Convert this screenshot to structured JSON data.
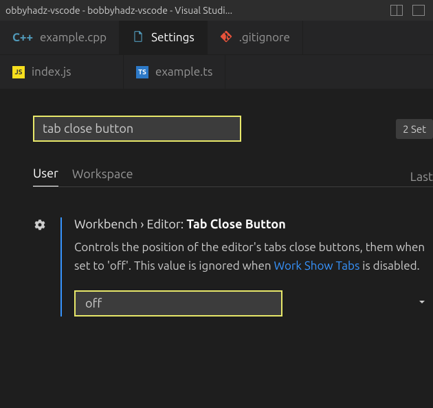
{
  "titlebar": {
    "text": "obbyhadz-vscode - bobbyhadz-vscode - Visual Studi..."
  },
  "tabs_row1": [
    {
      "name": "example-cpp",
      "label": "example.cpp",
      "icon": "cpp",
      "active": false
    },
    {
      "name": "settings",
      "label": "Settings",
      "icon": "file",
      "active": true
    },
    {
      "name": "gitignore",
      "label": ".gitignore",
      "icon": "git",
      "active": false
    }
  ],
  "tabs_row2": [
    {
      "name": "index-js",
      "label": "index.js",
      "icon": "js",
      "active": false
    },
    {
      "name": "example-ts",
      "label": "example.ts",
      "icon": "ts",
      "active": false
    }
  ],
  "settings": {
    "search_value": "tab close button",
    "count_label": "2 Set",
    "scope": {
      "user": "User",
      "workspace": "Workspace",
      "right": "Last"
    },
    "item": {
      "breadcrumb": "Workbench › Editor:",
      "name": "Tab Close Button",
      "desc_part1": "Controls the position of the editor's tabs close buttons",
      "desc_part2": "them when set to 'off'. This value is ignored when ",
      "link1": "Work",
      "link2": "Show Tabs",
      "desc_part3": " is disabled.",
      "value": "off"
    }
  }
}
